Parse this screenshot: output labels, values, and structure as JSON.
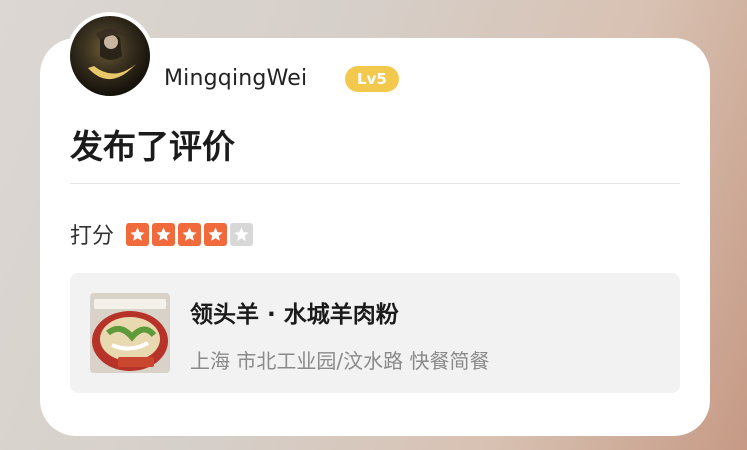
{
  "user": {
    "name": "MingqingWei",
    "level": "Lv5"
  },
  "post": {
    "headline": "发布了评价"
  },
  "rating": {
    "label": "打分",
    "stars_filled": 4,
    "stars_total": 5
  },
  "shop": {
    "name": "领头羊 · 水城羊肉粉",
    "meta": "上海 市北工业园/汶水路 快餐简餐"
  },
  "colors": {
    "badge": "#f2c94c",
    "star_on": "#f06a3b",
    "star_off": "#d8d8d8"
  }
}
